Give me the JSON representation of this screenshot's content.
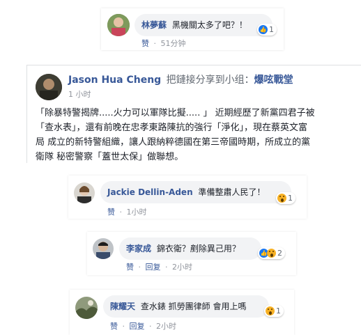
{
  "comment1": {
    "author": "林夢蘇",
    "text": "黑機關太多了吧？！",
    "reaction_count": "1",
    "like_label": "赞",
    "sep": "·",
    "time": "51分钟"
  },
  "post": {
    "author": "Jason Hua Cheng",
    "action": "把鏈接分享到小组：",
    "group": "爆呟戰堂",
    "time": "1 小时",
    "lines": [
      "「除暴特警揭牌.....火力可以軍隊比擬..... 」 近期經歷了新黨四君子被",
      "「查水表」，還有前晚在忠孝東路陳抗的強行「淨化」，現在蔡英文富",
      "局 成立的新特警組織，讓人跟納粹德國在第三帝國時期，所成立的黨",
      "衛隊 秘密警察「蓋世太保」做聯想。"
    ]
  },
  "comment2": {
    "author": "Jackie Dellin-Aden",
    "text": "準備整肅人民了！",
    "reaction_count": "1",
    "like_label": "赞",
    "sep": "·",
    "time": "1小时"
  },
  "comment3": {
    "author": "李家成",
    "text": "錦衣衛？剷除異己用？",
    "reaction_count": "2",
    "like_label": "赞",
    "reply_label": "回复",
    "sep": "·",
    "time": "2小时"
  },
  "comment4": {
    "author": "陳耀天",
    "text": "查水錶 抓勞團律師 會用上嗎",
    "reaction_count": "1",
    "like_label": "赞",
    "reply_label": "回复",
    "sep": "·",
    "time": "2小时"
  },
  "colors": {
    "link": "#385898",
    "bubble": "#f2f3f5",
    "meta": "#90949c",
    "like": "#1877f2",
    "wow": "#f7b125"
  }
}
